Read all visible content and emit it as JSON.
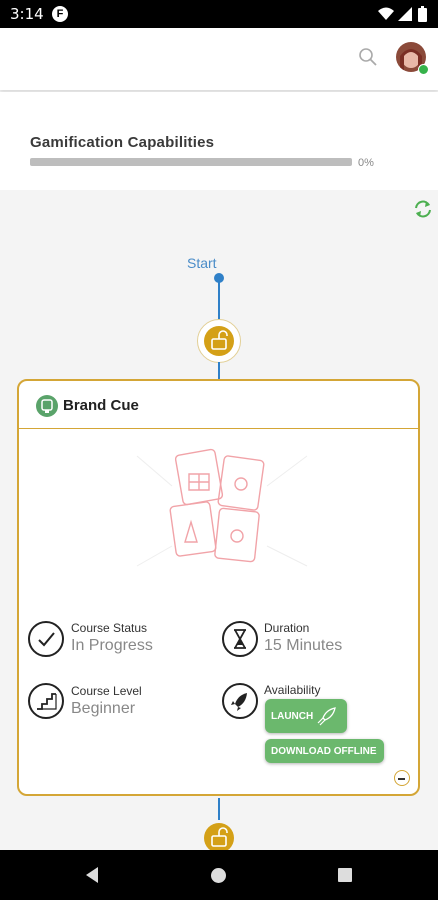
{
  "status_bar": {
    "time": "3:14",
    "app_icon_letter": "F"
  },
  "header": {
    "avatar": "user-avatar"
  },
  "gamification": {
    "title": "Gamification Capabilities",
    "progress_text": "0%",
    "progress": 0
  },
  "path": {
    "start_label": "Start"
  },
  "card": {
    "title": "Brand Cue",
    "course_status_label": "Course Status",
    "course_status_value": "In Progress",
    "duration_label": "Duration",
    "duration_value": "15 Minutes",
    "course_level_label": "Course Level",
    "course_level_value": "Beginner",
    "availability_label": "Availability",
    "launch_label": "LAUNCH",
    "download_label": "DOWNLOAD OFFLINE"
  },
  "colors": {
    "accent": "#d4a636",
    "green": "#6bb86d",
    "path_blue": "#2f80c8"
  }
}
